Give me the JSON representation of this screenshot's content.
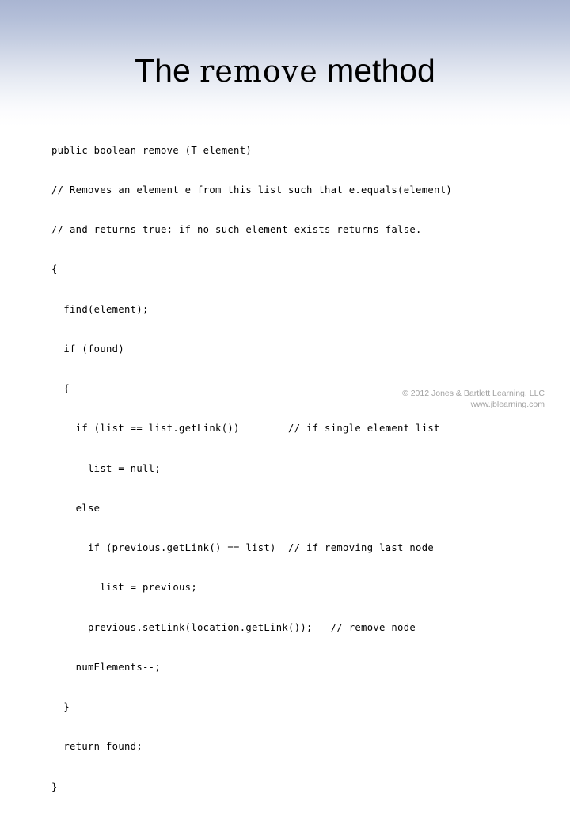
{
  "slide": {
    "title": {
      "prefix": "The ",
      "mono_word": "remove",
      "suffix": " method",
      "full": "The remove method"
    },
    "background": {
      "top_color": "#a9b5d2",
      "bottom_color": "#ffffff"
    },
    "code": {
      "language": "java",
      "text_color": "#000000",
      "lines": [
        "public boolean remove (T element)",
        "// Removes an element e from this list such that e.equals(element)",
        "// and returns true; if no such element exists returns false.",
        "{",
        "  find(element);",
        "  if (found)",
        "  {",
        "    if (list == list.getLink())        // if single element list",
        "      list = null;",
        "    else",
        "      if (previous.getLink() == list)  // if removing last node",
        "        list = previous;",
        "      previous.setLink(location.getLink());   // remove node",
        "    numElements--;",
        "  }",
        "  return found;",
        "}"
      ]
    },
    "footer": {
      "copyright": "© 2012 Jones & Bartlett Learning, LLC",
      "website": "www.jblearning.com",
      "text_color": "#a2a2a2"
    }
  }
}
